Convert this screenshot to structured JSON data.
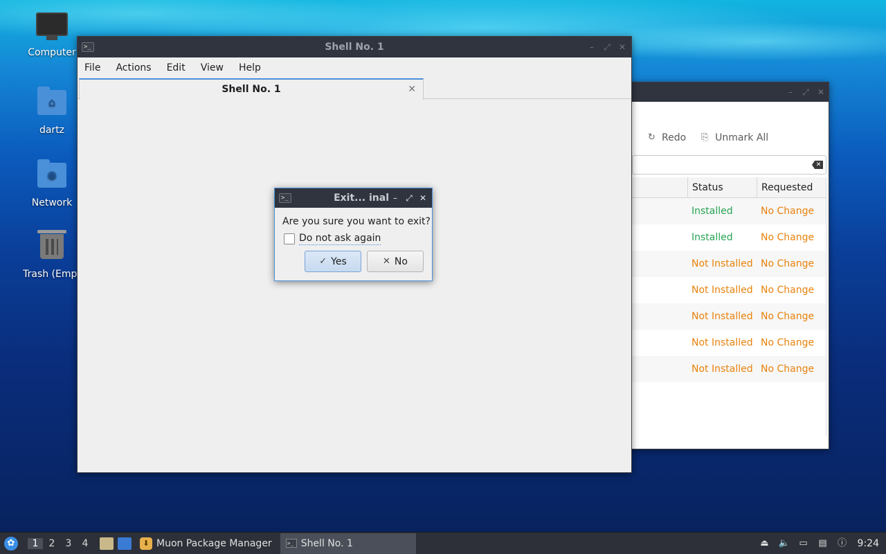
{
  "desktop": {
    "icons": [
      {
        "label": "Computer"
      },
      {
        "label": "dartz"
      },
      {
        "label": "Network"
      },
      {
        "label": "Trash (Empt"
      }
    ]
  },
  "muon": {
    "toolbar": {
      "redo": "Redo",
      "unmark_all": "Unmark All"
    },
    "columns": {
      "status": "Status",
      "requested": "Requested"
    },
    "rows": [
      {
        "status": "Installed",
        "requested": "No Change"
      },
      {
        "status": "Installed",
        "requested": "No Change"
      },
      {
        "status": "Not Installed",
        "requested": "No Change"
      },
      {
        "status": "Not Installed",
        "requested": "No Change"
      },
      {
        "status": "Not Installed",
        "requested": "No Change"
      },
      {
        "status": "Not Installed",
        "requested": "No Change"
      },
      {
        "status": "Not Installed",
        "requested": "No Change"
      }
    ],
    "colors": {
      "installed": "#27a453",
      "not_installed": "#e8820c",
      "requested": "#e8820c"
    }
  },
  "shell": {
    "title": "Shell No. 1",
    "menu": [
      "File",
      "Actions",
      "Edit",
      "View",
      "Help"
    ],
    "tab_label": "Shell No. 1"
  },
  "dialog": {
    "title": "Exit...  inal",
    "question": "Are you sure you want to exit?",
    "checkbox_label": "Do not ask again",
    "checkbox_checked": false,
    "yes_label": "Yes",
    "no_label": "No"
  },
  "taskbar": {
    "workspaces": [
      "1",
      "2",
      "3",
      "4"
    ],
    "active_workspace": "1",
    "tasks": [
      {
        "label": "Muon Package Manager",
        "icon": "package-icon"
      },
      {
        "label": "Shell No. 1",
        "icon": "terminal-icon"
      }
    ],
    "clock": "9:24"
  }
}
